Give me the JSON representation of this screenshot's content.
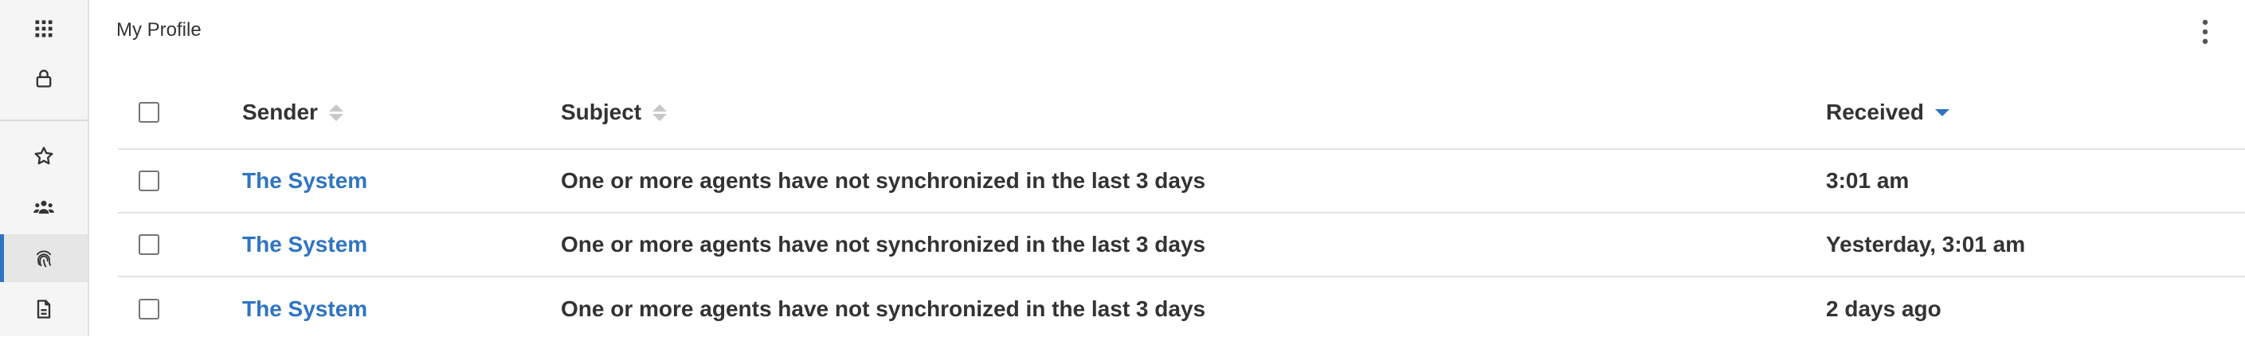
{
  "sidebar": {
    "items": [
      {
        "icon": "apps-grid-icon"
      },
      {
        "icon": "lock-icon"
      },
      {
        "icon": "star-icon"
      },
      {
        "icon": "users-icon"
      },
      {
        "icon": "fingerprint-icon",
        "active": true
      },
      {
        "icon": "document-icon"
      }
    ],
    "accent_color": "#2f74c0"
  },
  "header": {
    "title": "My Profile",
    "menu_icon": "more-vertical-icon"
  },
  "table": {
    "columns": [
      {
        "label": "Sender",
        "sortable": true
      },
      {
        "label": "Subject",
        "sortable": true
      },
      {
        "label": "Received",
        "sortable": true,
        "sorted": "descending"
      }
    ],
    "rows": [
      {
        "sender": "The System",
        "subject": "One or more agents have not synchronized in the last 3 days",
        "received": "3:01 am"
      },
      {
        "sender": "The System",
        "subject": "One or more agents have not synchronized in the last 3 days",
        "received": "Yesterday, 3:01 am"
      },
      {
        "sender": "The System",
        "subject": "One or more agents have not synchronized in the last 3 days",
        "received": "2 days ago"
      }
    ]
  }
}
